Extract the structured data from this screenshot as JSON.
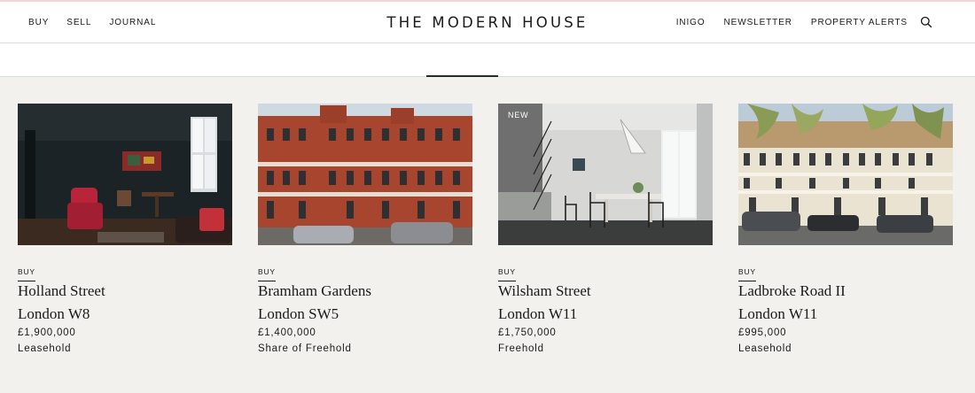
{
  "colors": {
    "page_background": "#f3f1ed",
    "header_background": "#ffffff",
    "accent_line": "#f4d6d8",
    "text": "#1a1a1a"
  },
  "header": {
    "nav_left": [
      "BUY",
      "SELL",
      "JOURNAL"
    ],
    "logo": "THE MODERN HOUSE",
    "nav_right": [
      "INIGO",
      "NEWSLETTER",
      "PROPERTY ALERTS"
    ],
    "search_icon": "search-icon"
  },
  "listings": [
    {
      "tag": "BUY",
      "badge": "",
      "title": "Holland Street",
      "area": "London W8",
      "price": "£1,900,000",
      "tenure": "Leasehold",
      "image": "dark-interior-living-room-photo"
    },
    {
      "tag": "BUY",
      "badge": "",
      "title": "Bramham Gardens",
      "area": "London SW5",
      "price": "£1,400,000",
      "tenure": "Share of Freehold",
      "image": "red-brick-mansion-block-photo"
    },
    {
      "tag": "BUY",
      "badge": "NEW",
      "title": "Wilsham Street",
      "area": "London W11",
      "price": "£1,750,000",
      "tenure": "Freehold",
      "image": "white-dining-room-photo"
    },
    {
      "tag": "BUY",
      "badge": "",
      "title": "Ladbroke Road II",
      "area": "London W11",
      "price": "£995,000",
      "tenure": "Leasehold",
      "image": "stucco-terrace-street-photo"
    }
  ]
}
